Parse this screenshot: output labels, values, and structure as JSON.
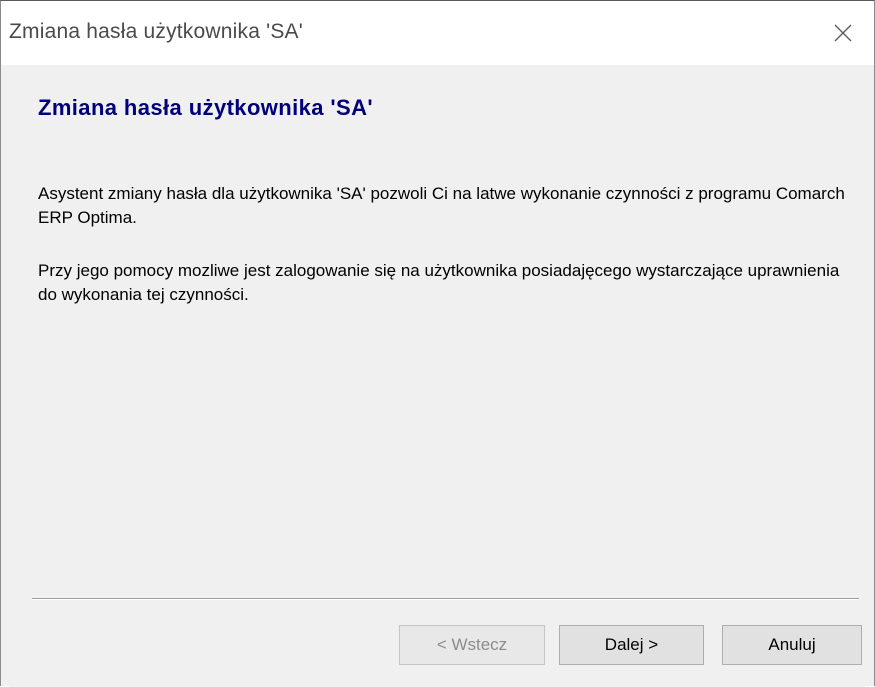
{
  "window": {
    "title": "Zmiana hasła użytkownika 'SA'"
  },
  "content": {
    "heading": "Zmiana hasła użytkownika 'SA'",
    "paragraph1": "Asystent zmiany hasła dla użytkownika 'SA' pozwoli Ci na latwe wykonanie czynności z programu Comarch ERP Optima.",
    "paragraph2": "Przy jego pomocy mozliwe jest zalogowanie się na użytkownika posiadajęcego wystarczające uprawnienia do wykonania tej czynności."
  },
  "buttons": {
    "back_label": "< Wstecz",
    "next_label": "Dalej >",
    "cancel_label": "Anuluj"
  },
  "icons": {
    "close": "close-icon"
  },
  "colors": {
    "heading": "#00007a",
    "dialog_background": "#f0f0f0",
    "disabled_text": "#8c8c8c"
  }
}
